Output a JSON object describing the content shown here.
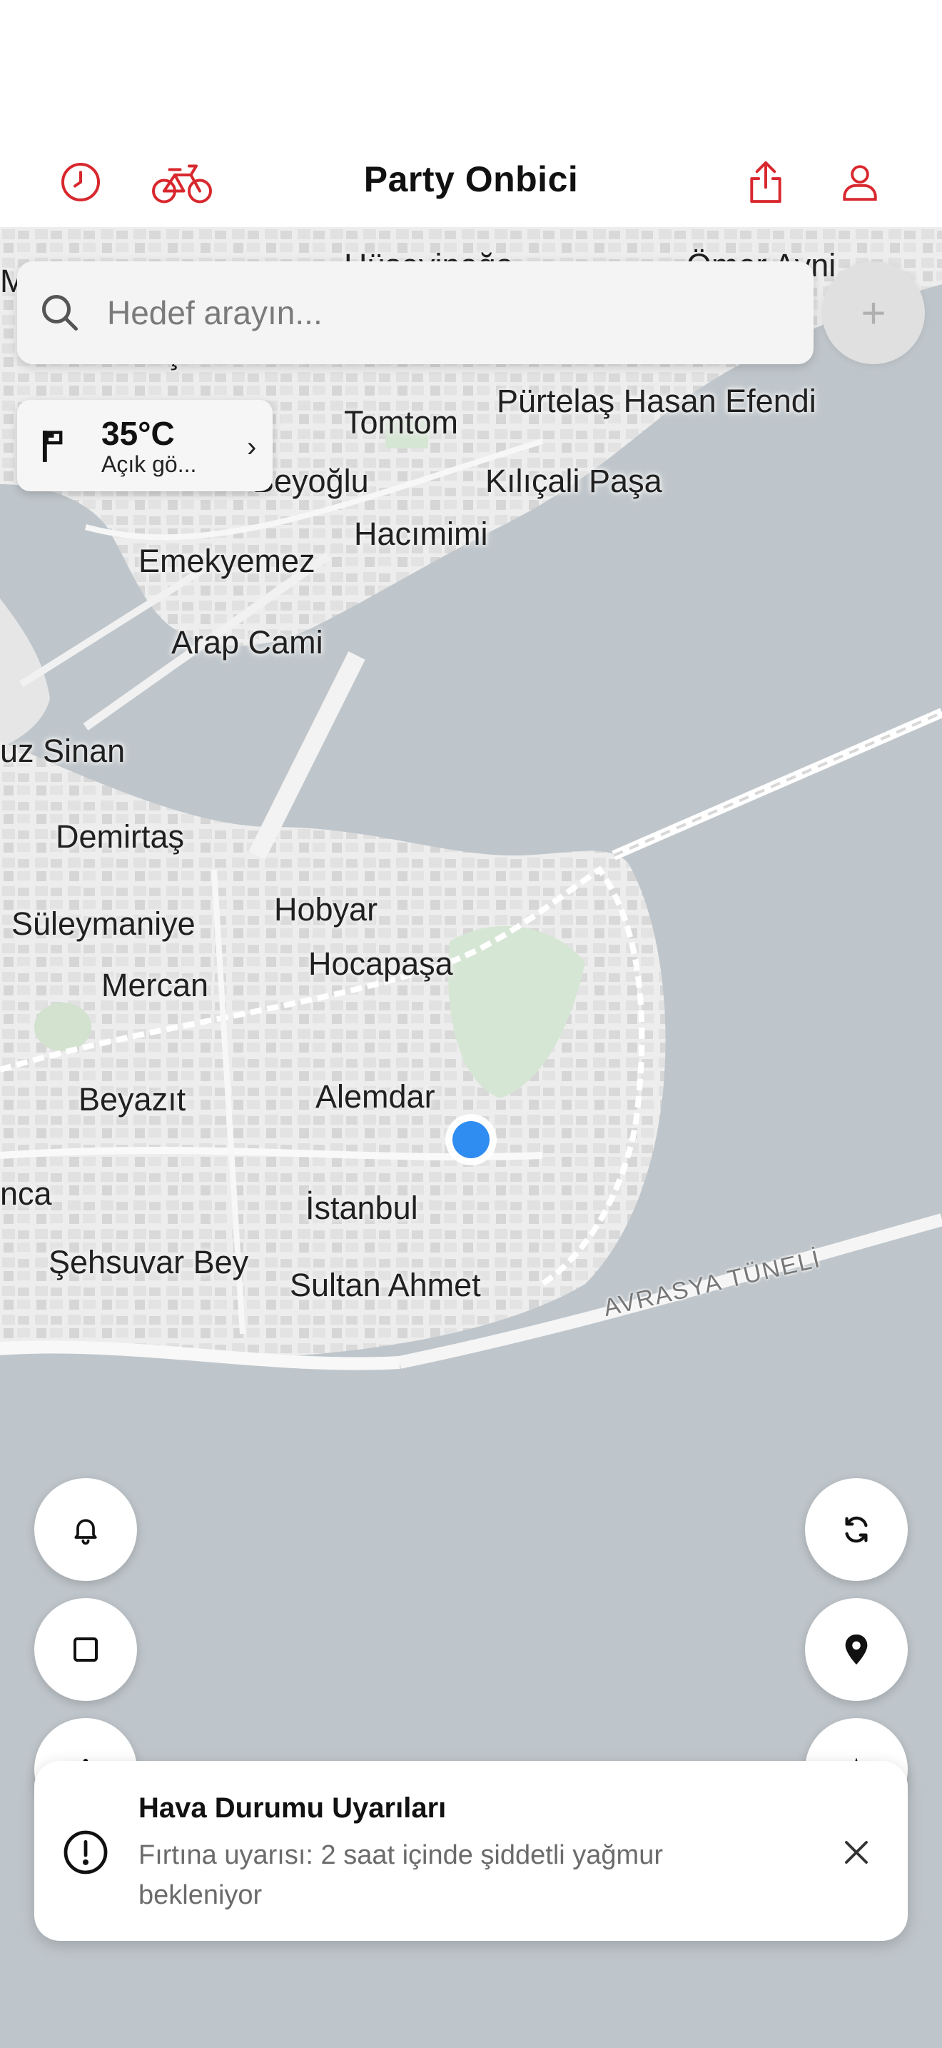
{
  "header": {
    "title": "Party Onbici",
    "left_icons": [
      "clock-icon",
      "bicycle-icon"
    ],
    "right_icons": [
      "share-icon",
      "user-icon"
    ],
    "accent_color": "#d8272d"
  },
  "search": {
    "placeholder": "Hedef arayın...",
    "add_label": "+"
  },
  "weather": {
    "temperature": "35°C",
    "description": "Açık gö...",
    "chevron": "›"
  },
  "map": {
    "places": [
      "Hüseyinağa",
      "Ömer Avni",
      "Çatma Mescit",
      "Pürtelaş Hasan Efendi",
      "Tomtom",
      "Beyoğlu",
      "Kılıçali Paşa",
      "Hacımimi",
      "Emekyemez",
      "Arap Cami",
      "uz Sinan",
      "Demirtaş",
      "Süleymaniye",
      "Hobyar",
      "Hocapaşa",
      "Mercan",
      "Beyazıt",
      "Alemdar",
      "İstanbul",
      "nca",
      "Şehsuvar Bey",
      "Sultan Ahmet",
      "M"
    ],
    "tunnel_label": "AVRASYA TÜNELİ",
    "user_location_color": "#2f8cf0"
  },
  "controls": {
    "left": [
      "bell-icon",
      "square-icon",
      "more-icon"
    ],
    "right": [
      "refresh-icon",
      "location-pin-icon",
      "navigation-icon"
    ]
  },
  "alert": {
    "title": "Hava Durumu Uyarıları",
    "message": "Fırtına uyarısı: 2 saat içinde şiddetli yağmur bekleniyor",
    "close_icon": "close-icon"
  }
}
